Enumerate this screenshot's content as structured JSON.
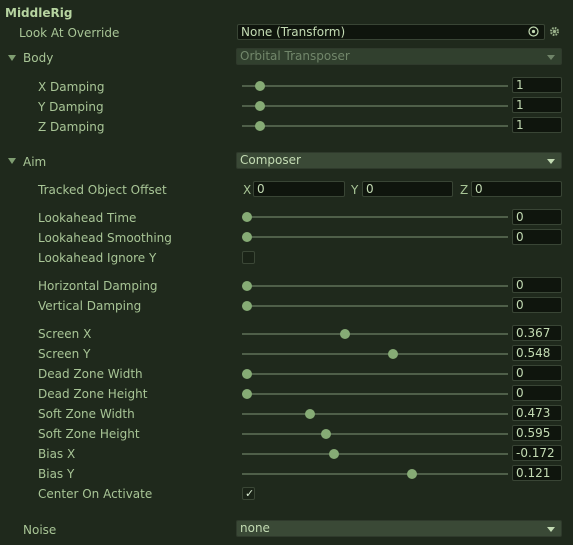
{
  "title": "MiddleRig",
  "look_at_override": {
    "label": "Look At Override",
    "value": "None (Transform)"
  },
  "body": {
    "label": "Body",
    "mode": "Orbital Transposer",
    "rows": [
      {
        "label": "X Damping",
        "value": "1",
        "ratio": 0.05
      },
      {
        "label": "Y Damping",
        "value": "1",
        "ratio": 0.05
      },
      {
        "label": "Z Damping",
        "value": "1",
        "ratio": 0.05
      }
    ]
  },
  "aim": {
    "label": "Aim",
    "mode": "Composer",
    "tracked_offset": {
      "label": "Tracked Object Offset",
      "x_label": "X",
      "x": "0",
      "y_label": "Y",
      "y": "0",
      "z_label": "Z",
      "z": "0"
    },
    "lookahead_time": {
      "label": "Lookahead Time",
      "value": "0",
      "ratio": 0
    },
    "lookahead_smoothing": {
      "label": "Lookahead Smoothing",
      "value": "0",
      "ratio": 0
    },
    "lookahead_ignore_y": {
      "label": "Lookahead Ignore Y",
      "checked": false
    },
    "horizontal_damping": {
      "label": "Horizontal Damping",
      "value": "0",
      "ratio": 0
    },
    "vertical_damping": {
      "label": "Vertical Damping",
      "value": "0",
      "ratio": 0
    },
    "screen_x": {
      "label": "Screen X",
      "value": "0.367",
      "ratio": 0.367
    },
    "screen_y": {
      "label": "Screen Y",
      "value": "0.548",
      "ratio": 0.548
    },
    "dead_zone_width": {
      "label": "Dead Zone Width",
      "value": "0",
      "ratio": 0
    },
    "dead_zone_height": {
      "label": "Dead Zone Height",
      "value": "0",
      "ratio": 0
    },
    "soft_zone_width": {
      "label": "Soft Zone Width",
      "value": "0.473",
      "ratio": 0.237
    },
    "soft_zone_height": {
      "label": "Soft Zone Height",
      "value": "0.595",
      "ratio": 0.298
    },
    "bias_x": {
      "label": "Bias X",
      "value": "-0.172",
      "ratio": 0.328
    },
    "bias_y": {
      "label": "Bias Y",
      "value": "0.121",
      "ratio": 0.621
    },
    "center_on_activate": {
      "label": "Center On Activate",
      "checked": true
    }
  },
  "noise": {
    "label": "Noise",
    "value": "none"
  },
  "icons": {
    "target": "target-icon",
    "settings": "gear-icon"
  },
  "colors": {
    "background": "#1f291c",
    "text": "#a8c596",
    "accent": "#86ab75"
  }
}
